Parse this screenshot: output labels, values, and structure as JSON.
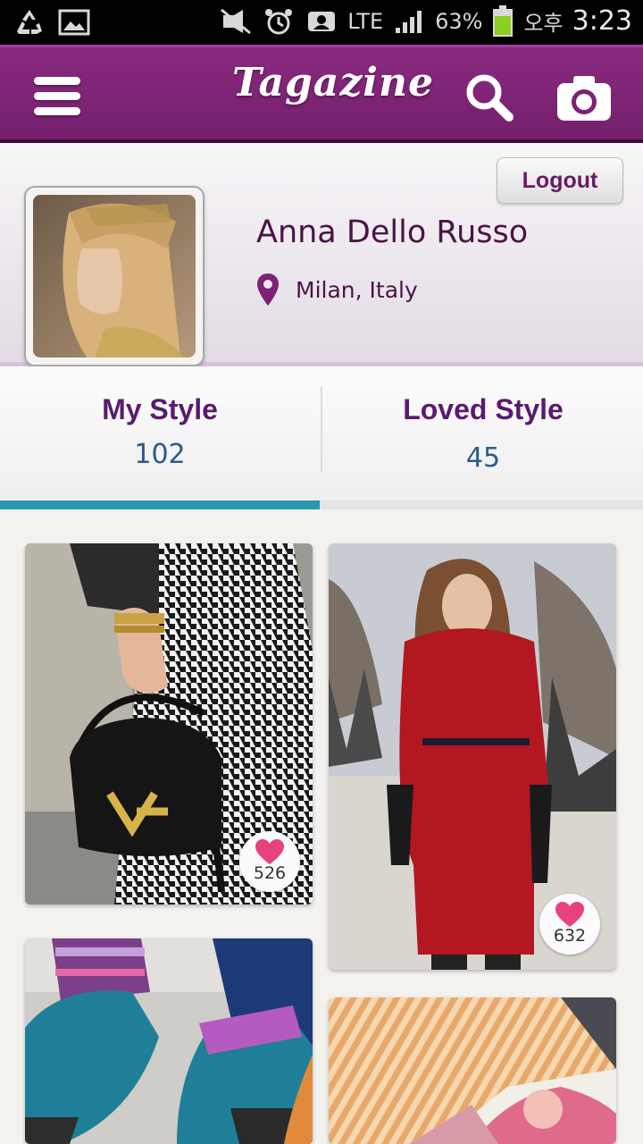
{
  "status_bar": {
    "battery": "63%",
    "network": "LTE",
    "ampm": "오후",
    "time": "3:23"
  },
  "app_bar": {
    "logo": "Tagazine"
  },
  "profile": {
    "logout_label": "Logout",
    "name": "Anna Dello Russo",
    "location": "Milan, Italy"
  },
  "tabs": [
    {
      "label": "My Style",
      "count": "102"
    },
    {
      "label": "Loved Style",
      "count": "45"
    }
  ],
  "feed": {
    "items": [
      {
        "likes": "526"
      },
      {
        "likes": "632"
      }
    ]
  },
  "colors": {
    "brand_purple": "#7b2374",
    "accent_teal": "#2a97b0",
    "heart_pink": "#e8427e"
  }
}
